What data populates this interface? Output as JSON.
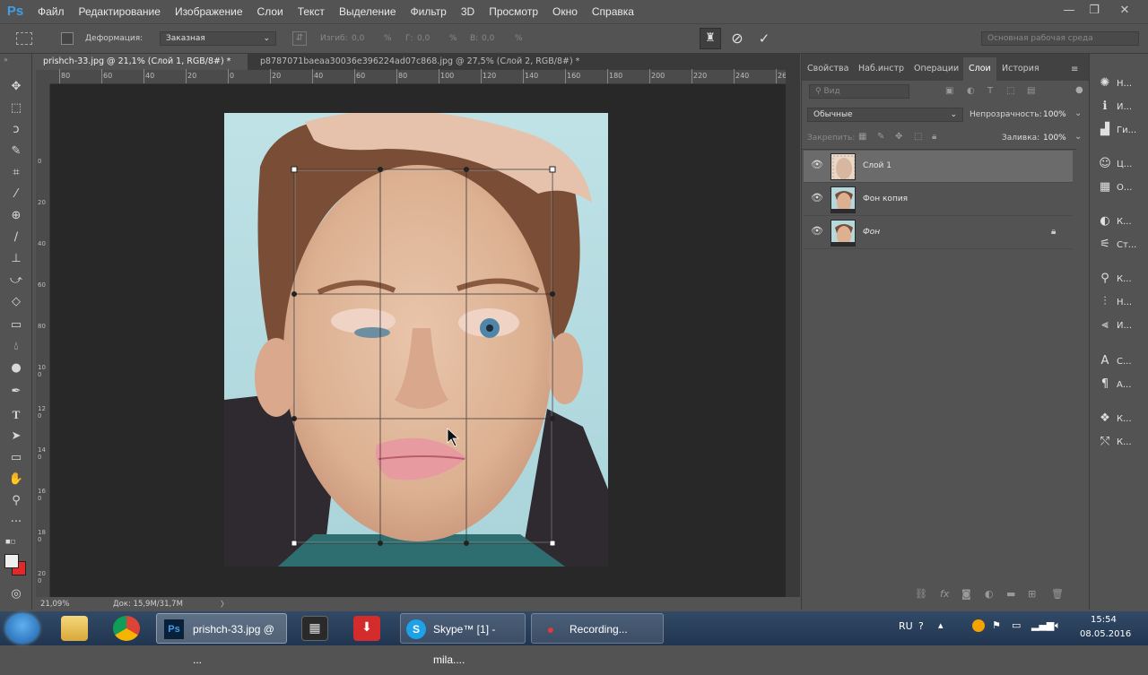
{
  "app": {
    "logo": "Ps"
  },
  "menu": [
    "Файл",
    "Редактирование",
    "Изображение",
    "Слои",
    "Текст",
    "Выделение",
    "Фильтр",
    "3D",
    "Просмотр",
    "Окно",
    "Справка"
  ],
  "options": {
    "deform_label": "Деформация:",
    "deform_value": "Заказная",
    "bend_label": "Изгиб:",
    "bend_value": "0,0",
    "h_label": "Г:",
    "h_value": "0,0",
    "v_label": "В:",
    "v_value": "0,0",
    "percent": "%",
    "workspace": "Основная рабочая среда"
  },
  "tabs": [
    {
      "label": "prishch-33.jpg @ 21,1% (Слой 1, RGB/8#) *",
      "close": "×",
      "active": true
    },
    {
      "label": "p8787071baeaa30036e396224ad07c868.jpg @ 27,5% (Слой 2, RGB/8#) *",
      "close": "×",
      "active": false
    }
  ],
  "ruler_h": [
    "80",
    "60",
    "40",
    "20",
    "0",
    "20",
    "40",
    "60",
    "80",
    "100",
    "120",
    "140",
    "160",
    "180",
    "200",
    "220",
    "240",
    "260"
  ],
  "ruler_v": [
    "0",
    "2 0",
    "4 0",
    "6 0",
    "8 0",
    "1 0 0",
    "1 2 0",
    "1 4 0",
    "1 6 0",
    "1 8 0",
    "2 0 0",
    "2 2 0"
  ],
  "status": {
    "zoom": "21,09%",
    "doc": "Док: 15,9M/31,7M",
    "arrow": "〉"
  },
  "panel_tabs": [
    "Свойства",
    "Наб.инстр",
    "Операции",
    "Слои",
    "История"
  ],
  "layers_panel": {
    "filter_placeholder": "Вид",
    "blend_mode": "Обычные",
    "opacity_label": "Непрозрачность:",
    "opacity_value": "100%",
    "lock_label": "Закрепить:",
    "fill_label": "Заливка:",
    "fill_value": "100%",
    "layers": [
      {
        "name": "Слой 1",
        "selected": true,
        "locked": false
      },
      {
        "name": "Фон копия",
        "selected": false,
        "locked": false
      },
      {
        "name": "Фон",
        "selected": false,
        "locked": true
      }
    ]
  },
  "dock": [
    {
      "icon": "✺",
      "label": "Н..."
    },
    {
      "icon": "ℹ",
      "label": "И..."
    },
    {
      "icon": "▟",
      "label": "Ги..."
    },
    {
      "icon": "☺",
      "label": "Ц..."
    },
    {
      "icon": "▦",
      "label": "О..."
    },
    {
      "icon": "◐",
      "label": "К..."
    },
    {
      "icon": "⚟",
      "label": "Ст..."
    },
    {
      "icon": "⚲",
      "label": "К..."
    },
    {
      "icon": "⫶",
      "label": "Н..."
    },
    {
      "icon": "⫷",
      "label": "И..."
    },
    {
      "icon": "A",
      "label": "С..."
    },
    {
      "icon": "¶",
      "label": "А..."
    },
    {
      "icon": "❖",
      "label": "К..."
    },
    {
      "icon": "⤲",
      "label": "К..."
    }
  ],
  "taskbar": {
    "tasks": [
      {
        "label": "prishch-33.jpg @ ...",
        "icon": "Ps"
      },
      {
        "label": "Skype™ [1] - mila....",
        "icon": "S"
      },
      {
        "label": "Recording...",
        "icon": "●"
      }
    ],
    "lang": "RU",
    "time": "15:54",
    "date": "08.05.2016"
  }
}
